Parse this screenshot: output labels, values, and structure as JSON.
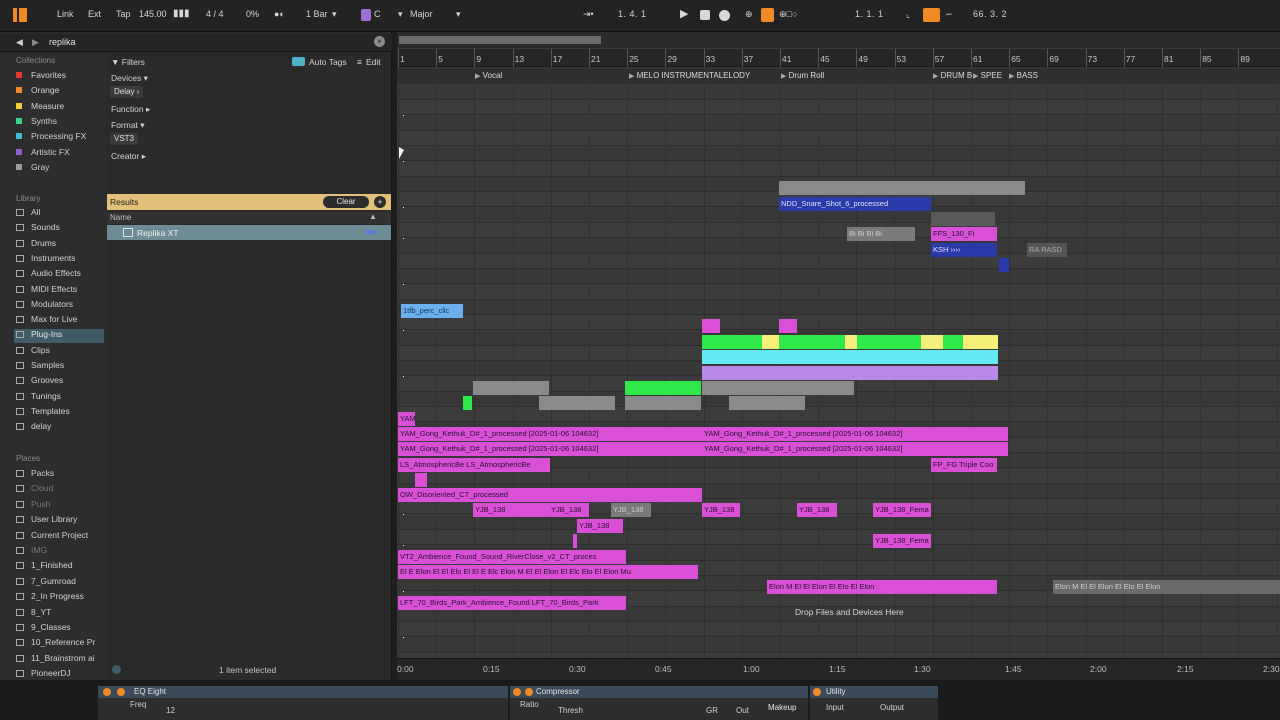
{
  "transport": {
    "link": "Link",
    "ext": "Ext",
    "tap": "Tap",
    "tempo": "145.00",
    "signature": "4 / 4",
    "cpu": "0%",
    "quantize": "1 Bar",
    "key": "C",
    "scale": "Major",
    "position": "1.   4.   1",
    "loop_start": "1.   1.   1",
    "loop_length": "66.   3.   2"
  },
  "browser": {
    "search_value": "replika",
    "collections_title": "Collections",
    "collections": [
      {
        "label": "Favorites",
        "color": "#e2372c"
      },
      {
        "label": "Orange",
        "color": "#f08a24"
      },
      {
        "label": "Measure",
        "color": "#ecd238"
      },
      {
        "label": "Synths",
        "color": "#3bd18a"
      },
      {
        "label": "Processing FX",
        "color": "#3bbcd0"
      },
      {
        "label": "Artistic FX",
        "color": "#8f5fd0"
      },
      {
        "label": "Gray",
        "color": "#9a9a9a"
      }
    ],
    "library_title": "Library",
    "library": [
      "All",
      "Sounds",
      "Drums",
      "Instruments",
      "Audio Effects",
      "MIDI Effects",
      "Modulators",
      "Max for Live",
      "Plug-Ins",
      "Clips",
      "Samples",
      "Grooves",
      "Tunings",
      "Templates",
      "delay"
    ],
    "places_title": "Places",
    "places": [
      "Packs",
      "Cloud",
      "Push",
      "User Library",
      "Current Project",
      "IMG",
      "1_Finished",
      "7_Gumroad",
      "2_In Progress",
      "8_YT",
      "9_Classes",
      "10_Reference Pr",
      "11_Brainstrom ai",
      "PioneerDJ"
    ],
    "filters_title": "Filters",
    "auto_tags": "Auto Tags",
    "edit": "Edit",
    "devices_label": "Devices ▾",
    "devices_chip": "Delay ›",
    "function_label": "Function ▸",
    "format_label": "Format ▾",
    "format_chip": "VST3",
    "creator_label": "Creator ▸",
    "results_label": "Results",
    "clear": "Clear",
    "name_col": "Name",
    "result_item": "Replika XT",
    "status": "1 item selected"
  },
  "arrangement": {
    "bar_numbers": [
      "1",
      "5",
      "9",
      "13",
      "17",
      "21",
      "25",
      "29",
      "33",
      "37",
      "41",
      "45",
      "49",
      "53",
      "57",
      "61",
      "65",
      "69",
      "73",
      "77",
      "81",
      "85",
      "89"
    ],
    "locators": [
      "Vocal",
      "MELO INSTRUMENTALELODY",
      "Drum Roll",
      "DRUM B",
      "SPEE",
      "BASS"
    ],
    "times": [
      "0:00",
      "0:15",
      "0:30",
      "0:45",
      "1:00",
      "1:15",
      "1:30",
      "1:45",
      "2:00",
      "2:15",
      "2:30"
    ],
    "drop_hint": "Drop Files and Devices Here",
    "clip_labels": {
      "snare": "NDD_Snare_Shot_6_processed",
      "perc": "1tfb_perc_clic",
      "bi": "Bi Bi Bi Bi",
      "ffs": "FFS_130_Fi",
      "ksh": "KSH ››››",
      "ra": "RA  RASD",
      "yam": "YAM",
      "gong1": "YAM_Gong_Kethuk_D#_1_processed [2025-01-06 104632]",
      "gong2": "YAM_Gong_Kethuk_D#_1_processed [2025-01-06 104632]",
      "atmos": "LS_AtmosphericBe  LS_AtmosphericBe",
      "fpfg": "FP_FG Triple Coo",
      "disor": "OW_Disoriented_CT_processed",
      "disor2": "OW_Disoriented_CT_processed",
      "yjb": "YJB_138",
      "yjbfem": "YJB_138_Fema",
      "ambience": "VT2_Ambience_Found_Sound_RiverClose_v2_CT_proces",
      "elon": "El E Elon El El Elo El El E Elc Elon M El El Elon El Elc Elo El Elon Mu",
      "elon2": "Elon M El El Elon El Elo El Elon",
      "birds": "LFT_70_Birds_Park_Ambience_Found  LFT_70_Birds_Park"
    }
  },
  "devices": {
    "eq": "EQ Eight",
    "eq_freq": "Freq",
    "eq_val": "12",
    "comp": "Compressor",
    "comp_ratio": "Ratio",
    "comp_thresh": "Thresh",
    "comp_gr": "GR",
    "comp_out": "Out",
    "comp_makeup": "Makeup",
    "util": "Utility",
    "util_input": "Input",
    "util_output": "Output"
  },
  "colors": {
    "accent": "#f08a24",
    "clip_pink": "#d94fd6",
    "clip_green": "#2fe84a",
    "clip_purple": "#b889e8",
    "clip_blue": "#2a3aa8",
    "clip_gray": "#8a8a8a",
    "results": "#e3c07a",
    "selection": "#6d8c96"
  }
}
